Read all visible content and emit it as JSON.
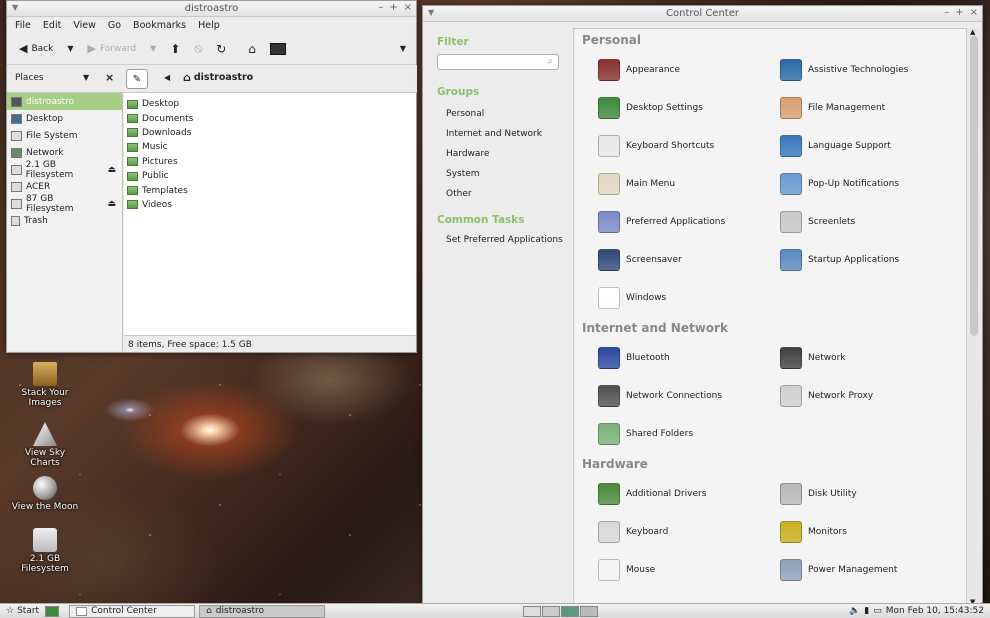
{
  "file_manager": {
    "title": "distroastro",
    "menu": [
      "File",
      "Edit",
      "View",
      "Go",
      "Bookmarks",
      "Help"
    ],
    "toolbar": {
      "back": "Back",
      "forward": "Forward"
    },
    "sidebar_header": "Places",
    "path": "distroastro",
    "places": [
      "distroastro",
      "Desktop",
      "File System",
      "Network",
      "2.1 GB Filesystem",
      "ACER",
      "87 GB Filesystem",
      "Trash"
    ],
    "files": [
      "Desktop",
      "Documents",
      "Downloads",
      "Music",
      "Pictures",
      "Public",
      "Templates",
      "Videos"
    ],
    "status": "8 items, Free space: 1.5 GB"
  },
  "control_center": {
    "title": "Control Center",
    "filter_label": "Filter",
    "groups_label": "Groups",
    "groups": [
      "Personal",
      "Internet and Network",
      "Hardware",
      "System",
      "Other"
    ],
    "common_tasks_label": "Common Tasks",
    "common_tasks": [
      "Set Preferred Applications"
    ],
    "sections": [
      {
        "name": "Personal",
        "items": [
          {
            "label": "Appearance",
            "color": "#8a3030"
          },
          {
            "label": "Assistive Technologies",
            "color": "#2a6aa8"
          },
          {
            "label": "Desktop Settings",
            "color": "#3c8a3c"
          },
          {
            "label": "File Management",
            "color": "#d8a070"
          },
          {
            "label": "Keyboard Shortcuts",
            "color": "#e8e8e8"
          },
          {
            "label": "Language Support",
            "color": "#3a78c0"
          },
          {
            "label": "Main Menu",
            "color": "#e0d8c0"
          },
          {
            "label": "Pop-Up Notifications",
            "color": "#6a9ad0"
          },
          {
            "label": "Preferred Applications",
            "color": "#7a8ac8"
          },
          {
            "label": "Screenlets",
            "color": "#c8c8c8"
          },
          {
            "label": "Screensaver",
            "color": "#304878"
          },
          {
            "label": "Startup Applications",
            "color": "#5a8ac0"
          },
          {
            "label": "Windows",
            "color": "#ffffff"
          }
        ]
      },
      {
        "name": "Internet and Network",
        "items": [
          {
            "label": "Bluetooth",
            "color": "#2a4aa0"
          },
          {
            "label": "Network",
            "color": "#404040"
          },
          {
            "label": "Network Connections",
            "color": "#505050"
          },
          {
            "label": "Network Proxy",
            "color": "#d0d0d0"
          },
          {
            "label": "Shared Folders",
            "color": "#7ab07a"
          }
        ]
      },
      {
        "name": "Hardware",
        "items": [
          {
            "label": "Additional Drivers",
            "color": "#4a8a3a"
          },
          {
            "label": "Disk Utility",
            "color": "#b8b8b8"
          },
          {
            "label": "Keyboard",
            "color": "#d8d8d8"
          },
          {
            "label": "Monitors",
            "color": "#c8b020"
          },
          {
            "label": "Mouse",
            "color": "#f4f4f4"
          },
          {
            "label": "Power Management",
            "color": "#90a0b8"
          }
        ]
      }
    ]
  },
  "desktop_icons": [
    {
      "label": "Stack Your Images"
    },
    {
      "label": "View Sky Charts"
    },
    {
      "label": "View the Moon"
    },
    {
      "label": "2.1 GB Filesystem"
    }
  ],
  "panel": {
    "start": "Start",
    "tasks": [
      "Control Center",
      "distroastro"
    ],
    "clock": "Mon Feb 10, 15:43:52"
  },
  "accent": "#8cc06c"
}
